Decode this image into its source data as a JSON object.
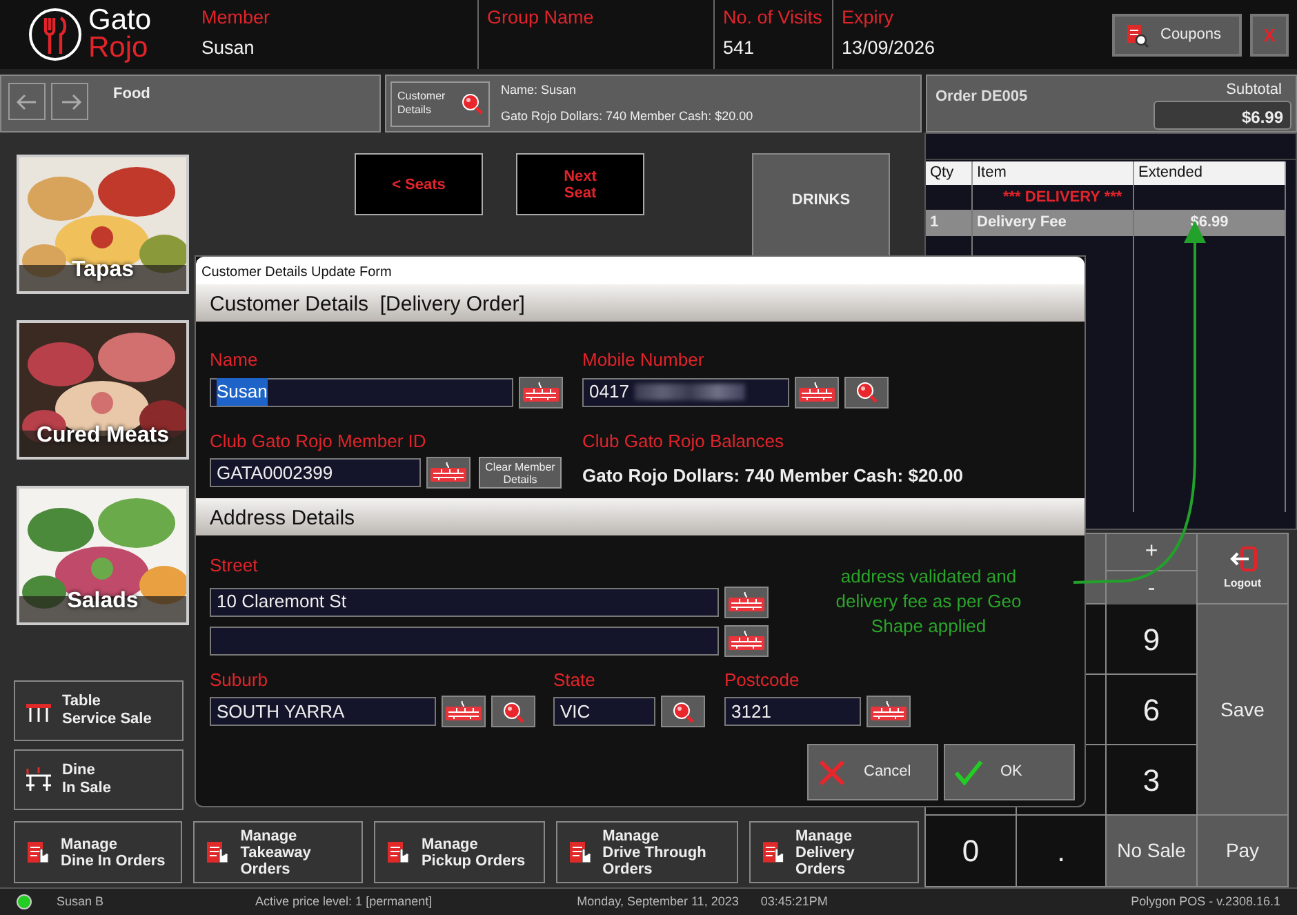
{
  "header": {
    "logo_top": "Gato",
    "logo_bottom": "Rojo",
    "fields": [
      {
        "label": "Member",
        "value": "Susan"
      },
      {
        "label": "Group Name"
      },
      {
        "label": "No. of Visits",
        "value": "541"
      },
      {
        "label": "Expiry",
        "value": "13/09/2026"
      }
    ],
    "coupons": "Coupons",
    "close": "X"
  },
  "category_bar": {
    "title": "Food"
  },
  "customer_bar": {
    "button": "Customer\nDetails",
    "name": "Name: Susan",
    "balances": "Gato Rojo Dollars: 740 Member Cash: $20.00"
  },
  "order_header": {
    "title": "Order DE005",
    "subtotal_label": "Subtotal",
    "subtotal": "$6.99"
  },
  "categories": [
    {
      "label": "Tapas"
    },
    {
      "label": "Cured Meats"
    },
    {
      "label": "Salads"
    }
  ],
  "sale_buttons": [
    {
      "label": "Table\nService Sale",
      "kind": "table"
    },
    {
      "label": "Dine\nIn Sale",
      "kind": "dine"
    }
  ],
  "seat_buttons": [
    {
      "label": "< Seats"
    },
    {
      "label": "Next\nSeat"
    }
  ],
  "drinks": "DRINKS",
  "order": {
    "columns": [
      "Qty",
      "Item",
      "Extended"
    ],
    "rows": [
      {
        "kind": "heading",
        "item": "*** DELIVERY ***",
        "selected": false
      },
      {
        "kind": "line",
        "qty": "1",
        "item": "Delivery Fee",
        "extended": "$6.99",
        "selected": true
      }
    ]
  },
  "keypad": {
    "plus": "+",
    "minus": "-",
    "logout": "Logout",
    "save": "Save",
    "digits": [
      "9",
      "6",
      "3"
    ],
    "bottom": [
      {
        "label": "0",
        "kind": "digit"
      },
      {
        "label": ".",
        "kind": "digit"
      },
      {
        "label": "No Sale",
        "kind": "action"
      },
      {
        "label": "Pay",
        "kind": "action"
      }
    ]
  },
  "manage_buttons": [
    "Manage\nDine In Orders",
    "Manage\nTakeaway\nOrders",
    "Manage\nPickup Orders",
    "Manage\nDrive Through\nOrders",
    "Manage\nDelivery Orders"
  ],
  "status_bar": {
    "online": true,
    "user": "Susan B",
    "price_level": "Active price level: 1 [permanent]",
    "date": "Monday, September 11, 2023",
    "time": "03:45:21PM",
    "version": "Polygon POS - v.2308.16.1"
  },
  "dialog": {
    "title": "Customer Details Update Form",
    "section": "Customer Details  [Delivery Order]",
    "name": {
      "label": "Name",
      "value": "Susan",
      "text_selected": true
    },
    "mobile": {
      "label": "Mobile Number",
      "value": "0417",
      "redacted": true
    },
    "member_id": {
      "label": "Club Gato Rojo Member ID",
      "value": "GATA0002399"
    },
    "clear_button": "Clear Member Details",
    "balances_label": "Club Gato Rojo Balances",
    "balances": "Gato Rojo Dollars: 740 Member Cash: $20.00",
    "address_section": "Address Details",
    "street_label": "Street",
    "street_lines": [
      {
        "kind": "text",
        "value": "10 Claremont St"
      },
      {
        "kind": "blank"
      }
    ],
    "suburb": {
      "label": "Suburb",
      "value": "SOUTH YARRA"
    },
    "state": {
      "label": "State",
      "value": "VIC"
    },
    "postcode": {
      "label": "Postcode",
      "value": "3121"
    },
    "cancel": "Cancel",
    "ok": "OK"
  },
  "annotation": {
    "text": "address validated and delivery fee as per Geo Shape applied"
  }
}
